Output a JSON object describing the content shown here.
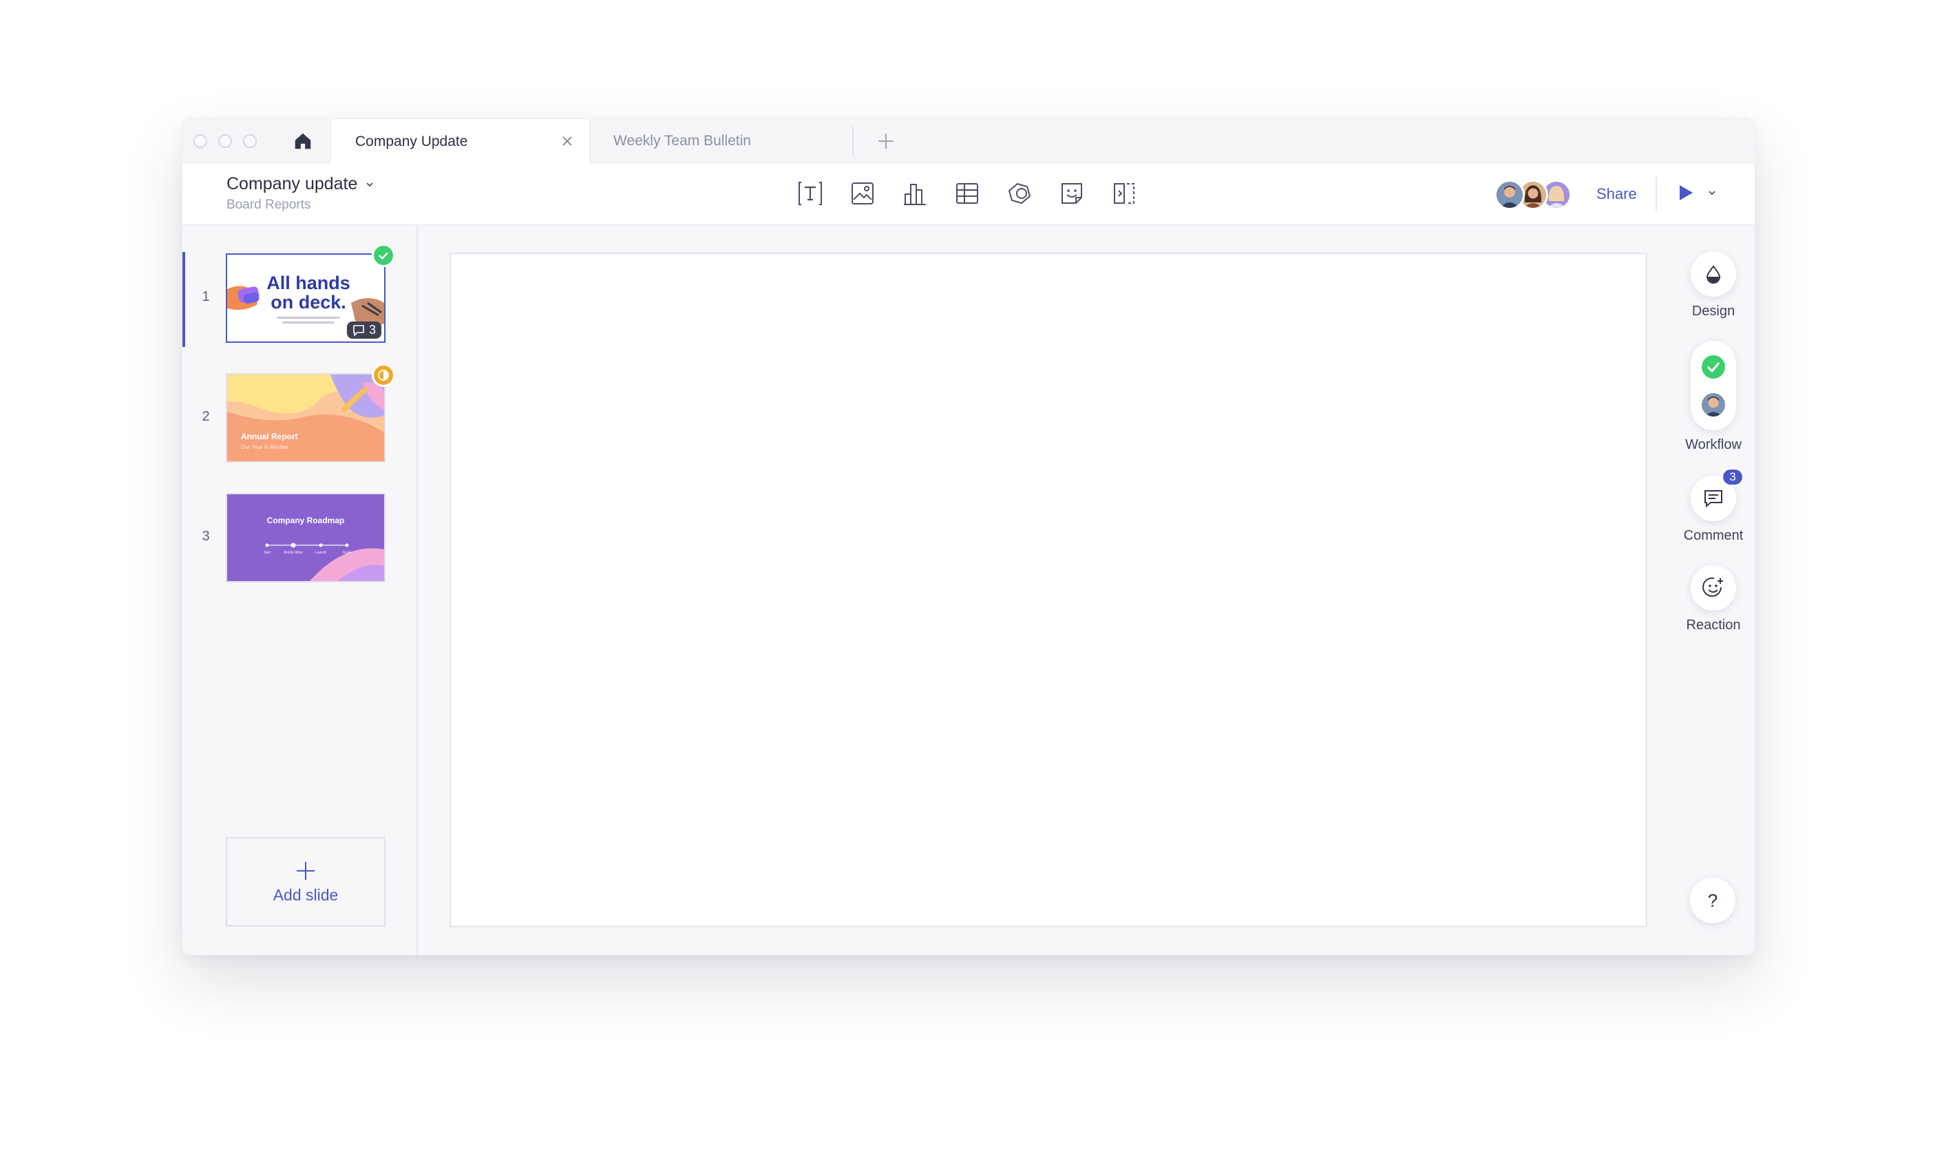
{
  "tabs": [
    {
      "label": "Company Update",
      "active": true
    },
    {
      "label": "Weekly Team Bulletin",
      "active": false
    }
  ],
  "document": {
    "title": "Company update",
    "subtitle": "Board Reports"
  },
  "toolbar": {
    "tools": [
      "text-icon",
      "image-icon",
      "chart-icon",
      "table-icon",
      "shape-icon",
      "sticker-icon",
      "layout-icon"
    ],
    "share_label": "Share",
    "collaborators": [
      "avatar-1",
      "avatar-2",
      "avatar-3"
    ]
  },
  "slides": [
    {
      "number": "1",
      "title_line1": "All hands",
      "title_line2": "on deck.",
      "status": "approved",
      "comment_count": "3"
    },
    {
      "number": "2",
      "title": "Annual Report",
      "subtitle": "Our Year in Review",
      "status": "in-progress"
    },
    {
      "number": "3",
      "title": "Company Roadmap",
      "milestones": [
        "Start",
        "Middle Miles",
        "Launch",
        "Scale"
      ]
    }
  ],
  "add_slide_label": "Add slide",
  "rail": {
    "design_label": "Design",
    "workflow_label": "Workflow",
    "comment_label": "Comment",
    "comment_badge": "3",
    "reaction_label": "Reaction",
    "help_label": "?"
  },
  "colors": {
    "accent": "#4a57c8",
    "approved": "#3ccf6e",
    "in_progress": "#f4a62a",
    "slide3_bg": "#8a62cf"
  }
}
